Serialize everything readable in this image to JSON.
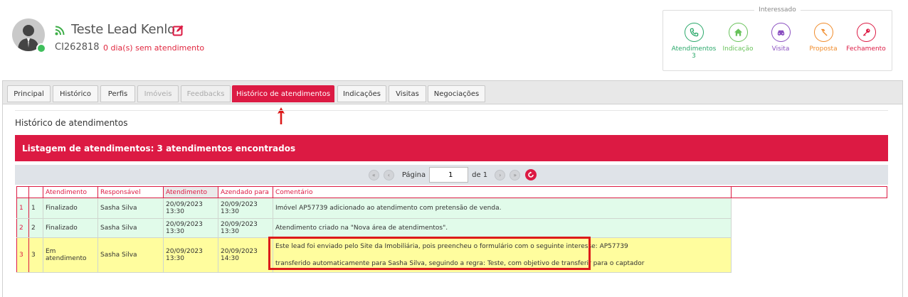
{
  "lead": {
    "name": "Teste Lead Kenlo",
    "code": "CI262818",
    "days_without_service": "0 dia(s) sem atendimento"
  },
  "stages": {
    "title": "Interessado",
    "items": [
      {
        "label": "Atendimentos",
        "count": "3",
        "icon": "phone-icon",
        "color": "#2aa86a"
      },
      {
        "label": "Indicação",
        "count": "",
        "icon": "home-icon",
        "color": "#68c25a"
      },
      {
        "label": "Visita",
        "count": "",
        "icon": "car-icon",
        "color": "#8a4fc0"
      },
      {
        "label": "Proposta",
        "count": "",
        "icon": "hammer-icon",
        "color": "#f08b2a"
      },
      {
        "label": "Fechamento",
        "count": "",
        "icon": "key-icon",
        "color": "#dc1a43"
      }
    ]
  },
  "tabs": [
    {
      "label": "Principal",
      "state": "normal"
    },
    {
      "label": "Histórico",
      "state": "normal"
    },
    {
      "label": "Perfis",
      "state": "normal"
    },
    {
      "label": "Imóveis",
      "state": "disabled"
    },
    {
      "label": "Feedbacks",
      "state": "disabled"
    },
    {
      "label": "Histórico de atendimentos",
      "state": "active"
    },
    {
      "label": "Indicações",
      "state": "normal"
    },
    {
      "label": "Visitas",
      "state": "normal"
    },
    {
      "label": "Negociações",
      "state": "normal"
    }
  ],
  "section": {
    "title": "Histórico de atendimentos",
    "list_header": "Listagem de atendimentos: 3 atendimentos encontrados"
  },
  "pager": {
    "page_label": "Página",
    "page_value": "1",
    "of_label": "de 1"
  },
  "table": {
    "columns": [
      "",
      "",
      "Atendimento",
      "Responsável",
      "Atendimento",
      "Azendado para",
      "Comentário",
      ""
    ],
    "rows": [
      {
        "index": "1",
        "num": "1",
        "status": "Finalizado",
        "responsible": "Sasha Silva",
        "service_date": "20/09/2023",
        "service_time": "13:30",
        "scheduled_date": "20/09/2023",
        "scheduled_time": "13:30",
        "comment": [
          "Imóvel AP57739 adicionado ao atendimento com pretensão de venda."
        ],
        "color": "green"
      },
      {
        "index": "2",
        "num": "2",
        "status": "Finalizado",
        "responsible": "Sasha Silva",
        "service_date": "20/09/2023",
        "service_time": "13:30",
        "scheduled_date": "20/09/2023",
        "scheduled_time": "13:30",
        "comment": [
          "Atendimento criado na \"Nova área de atendimentos\"."
        ],
        "color": "green"
      },
      {
        "index": "3",
        "num": "3",
        "status": "Em atendimento",
        "responsible": "Sasha Silva",
        "service_date": "20/09/2023",
        "service_time": "13:30",
        "scheduled_date": "20/09/2023",
        "scheduled_time": "14:30",
        "comment": [
          "Este lead foi enviado pelo Site da Imobiliária, pois preencheu o formulário com o seguinte interesse: AP57739",
          "transferido automaticamente para Sasha Silva, seguindo a regra: Teste, com objetivo de transferir para o captador"
        ],
        "color": "yellow"
      }
    ]
  }
}
